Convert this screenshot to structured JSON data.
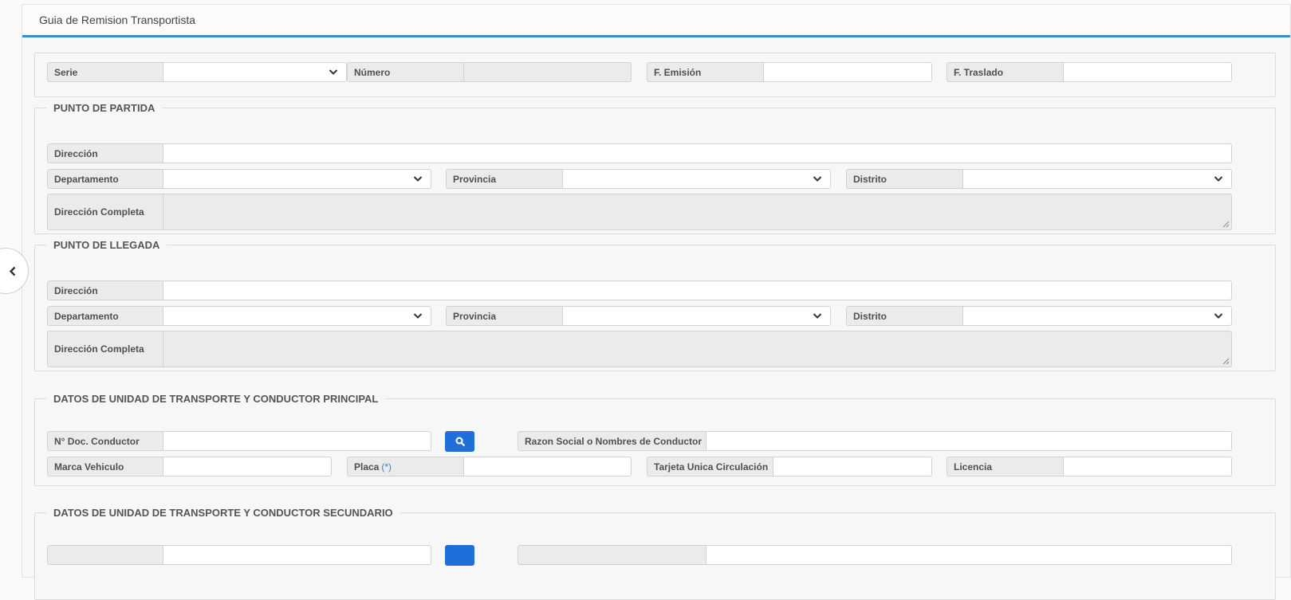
{
  "panel": {
    "title": "Guia de Remision Transportista"
  },
  "header_row": {
    "serie_label": "Serie",
    "serie_value": "",
    "numero_label": "Número",
    "numero_value": "",
    "emision_label": "F. Emisión",
    "emision_value": "",
    "traslado_label": "F. Traslado",
    "traslado_value": ""
  },
  "partida": {
    "legend": "PUNTO DE PARTIDA",
    "direccion_label": "Dirección",
    "direccion_value": "",
    "departamento_label": "Departamento",
    "departamento_value": "",
    "provincia_label": "Provincia",
    "provincia_value": "",
    "distrito_label": "Distrito",
    "distrito_value": "",
    "completa_label": "Dirección Completa",
    "completa_value": ""
  },
  "llegada": {
    "legend": "PUNTO DE LLEGADA",
    "direccion_label": "Dirección",
    "direccion_value": "",
    "departamento_label": "Departamento",
    "departamento_value": "",
    "provincia_label": "Provincia",
    "provincia_value": "",
    "distrito_label": "Distrito",
    "distrito_value": "",
    "completa_label": "Dirección Completa",
    "completa_value": ""
  },
  "principal": {
    "legend": "DATOS DE UNIDAD DE TRANSPORTE Y CONDUCTOR PRINCIPAL",
    "doc_label": "N° Doc. Conductor",
    "doc_value": "",
    "razon_label": "Razon Social o Nombres de Conductor",
    "razon_value": "",
    "marca_label": "Marca Vehiculo",
    "marca_value": "",
    "placa_label": "Placa",
    "placa_required": "(*)",
    "placa_value": "",
    "tarjeta_label": "Tarjeta Unica Circulación",
    "tarjeta_value": "",
    "licencia_label": "Licencia",
    "licencia_value": ""
  },
  "secundario": {
    "legend": "DATOS DE UNIDAD DE TRANSPORTE Y CONDUCTOR SECUNDARIO"
  },
  "icons": {
    "collapse": "chevron-left-icon",
    "search": "search-icon",
    "select": "chevron-down-icon"
  },
  "colors": {
    "accent": "#3b8fd0",
    "search_button": "#1e6fd9"
  }
}
